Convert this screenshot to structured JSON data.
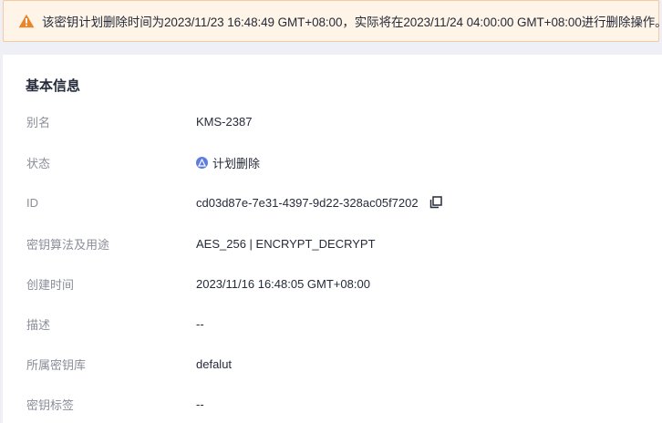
{
  "banner": {
    "message": "该密钥计划删除时间为2023/11/23 16:48:49 GMT+08:00，实际将在2023/11/24 04:00:00 GMT+08:00进行删除操作。",
    "icon": "warning-triangle-icon",
    "color": "#e6862d"
  },
  "basic_info": {
    "title": "基本信息",
    "rows": [
      {
        "label": "别名",
        "value": "KMS-2387"
      },
      {
        "label": "状态",
        "value": "计划删除"
      },
      {
        "label": "ID",
        "value": "cd03d87e-7e31-4397-9d22-328ac05f7202"
      },
      {
        "label": "密钥算法及用途",
        "value": "AES_256 | ENCRYPT_DECRYPT"
      },
      {
        "label": "创建时间",
        "value": "2023/11/16 16:48:05 GMT+08:00"
      },
      {
        "label": "描述",
        "value": "--"
      },
      {
        "label": "所属密钥库",
        "value": "defalut"
      },
      {
        "label": "密钥标签",
        "value": "--"
      }
    ]
  },
  "colors": {
    "status_icon": "#5e7ce0",
    "label": "#8a8e99",
    "value": "#252b3a"
  }
}
